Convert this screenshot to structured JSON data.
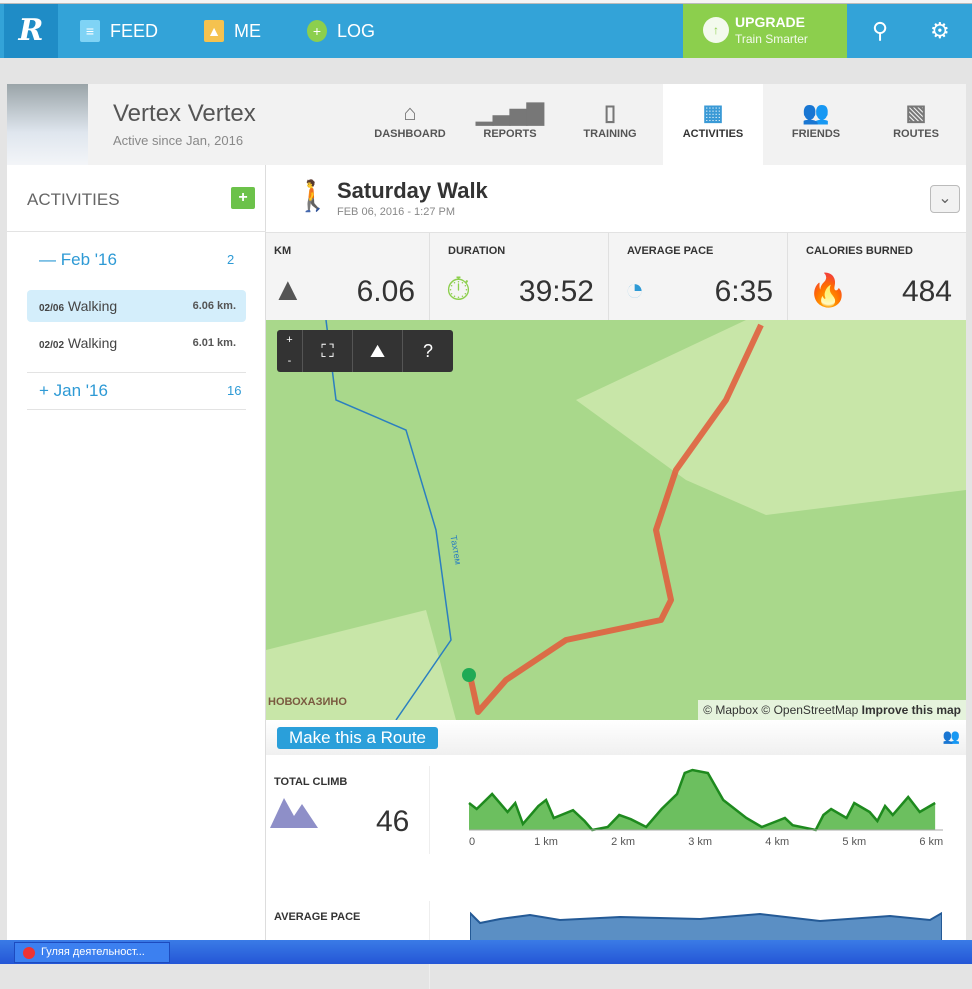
{
  "nav": {
    "feed": "FEED",
    "me": "ME",
    "log": "LOG",
    "upgrade_title": "UPGRADE",
    "upgrade_sub": "Train Smarter"
  },
  "profile": {
    "name": "Vertex Vertex",
    "since": "Active since Jan, 2016",
    "tabs": [
      "DASHBOARD",
      "REPORTS",
      "TRAINING",
      "ACTIVITIES",
      "FRIENDS",
      "ROUTES"
    ],
    "active_tab": "ACTIVITIES"
  },
  "sidebar": {
    "title": "ACTIVITIES",
    "months": [
      {
        "label": "Feb '16",
        "sign": "—",
        "count": "2"
      },
      {
        "label": "Jan '16",
        "sign": "+",
        "count": "16"
      }
    ],
    "activities": [
      {
        "date": "02/06",
        "type": "Walking",
        "dist": "6.06 km."
      },
      {
        "date": "02/02",
        "type": "Walking",
        "dist": "6.01 km."
      }
    ]
  },
  "activity": {
    "title": "Saturday Walk",
    "subtitle": "FEB 06, 2016  -  1:27 PM",
    "stats": [
      {
        "label": "KM",
        "value": "6.06"
      },
      {
        "label": "DURATION",
        "value": "39:52"
      },
      {
        "label": "AVERAGE PACE",
        "value": "6:35"
      },
      {
        "label": "CALORIES BURNED",
        "value": "484"
      }
    ]
  },
  "map": {
    "zoom_in": "+",
    "zoom_out": "-",
    "help": "?",
    "attribution": "© Mapbox © OpenStreetMap",
    "improve": "Improve this map",
    "place": "НОВОХАЗИНО",
    "river": "Тахтем"
  },
  "route_button": "Make this a Route",
  "climb": {
    "label": "TOTAL CLIMB",
    "value": "46"
  },
  "pace": {
    "label": "AVERAGE PACE"
  },
  "chart_data": {
    "type": "area",
    "xlabel": "",
    "ylabel": "",
    "xticks": [
      "0",
      "1 km",
      "2 km",
      "3 km",
      "4 km",
      "5 km",
      "6 km"
    ],
    "xlim": [
      0,
      6.1
    ],
    "x": [
      0,
      0.1,
      0.3,
      0.5,
      0.6,
      0.7,
      0.9,
      1.0,
      1.1,
      1.35,
      1.5,
      1.6,
      1.8,
      1.95,
      2.1,
      2.3,
      2.5,
      2.7,
      2.8,
      2.9,
      3.1,
      3.3,
      3.6,
      3.8,
      4.0,
      4.1,
      4.2,
      4.5,
      4.6,
      4.7,
      4.9,
      5.0,
      5.2,
      5.3,
      5.4,
      5.5,
      5.7,
      5.85,
      6.05
    ],
    "y": [
      0.45,
      0.35,
      0.6,
      0.3,
      0.45,
      0.1,
      0.4,
      0.5,
      0.2,
      0.33,
      0.15,
      0,
      0.05,
      0.25,
      0.18,
      0.05,
      0.35,
      0.6,
      0.95,
      1.0,
      0.95,
      0.5,
      0.2,
      0.05,
      0.15,
      0.2,
      0.08,
      0,
      0.25,
      0.35,
      0.2,
      0.45,
      0.3,
      0.15,
      0.4,
      0.25,
      0.55,
      0.3,
      0.45
    ],
    "color": "#1e8a1e",
    "fill": "#6cbf5f"
  },
  "taskbar": {
    "task": "Гуляя деятельност..."
  },
  "colors": {
    "nav": "#33a3d8",
    "upgrade": "#8ccf4d",
    "accent": "#2e9ad5"
  }
}
